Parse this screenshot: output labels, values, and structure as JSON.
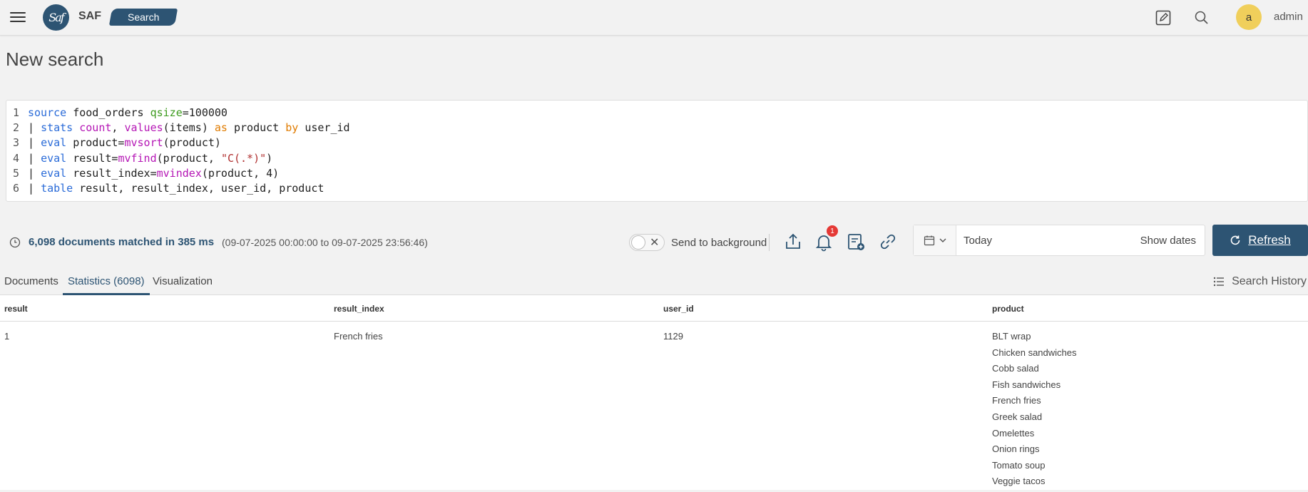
{
  "header": {
    "logo_text": "Saf",
    "app_name": "SAF",
    "nav_pill": "Search",
    "avatar_letter": "a",
    "username": "admin"
  },
  "page": {
    "title": "New search"
  },
  "editor": {
    "lines": [
      {
        "num": "1",
        "tokens": [
          [
            "kw",
            "source"
          ],
          [
            "plain",
            " food_orders "
          ],
          [
            "param",
            "qsize"
          ],
          [
            "plain",
            "=100000"
          ]
        ]
      },
      {
        "num": "2",
        "tokens": [
          [
            "plain",
            "| "
          ],
          [
            "kw",
            "stats "
          ],
          [
            "fn",
            "count"
          ],
          [
            "plain",
            ", "
          ],
          [
            "fn",
            "values"
          ],
          [
            "plain",
            "(items) "
          ],
          [
            "as",
            "as"
          ],
          [
            "plain",
            " product "
          ],
          [
            "as",
            "by"
          ],
          [
            "plain",
            " user_id"
          ]
        ]
      },
      {
        "num": "3",
        "tokens": [
          [
            "plain",
            "| "
          ],
          [
            "kw",
            "eval"
          ],
          [
            "plain",
            " product="
          ],
          [
            "fn",
            "mvsort"
          ],
          [
            "plain",
            "(product)"
          ]
        ]
      },
      {
        "num": "4",
        "tokens": [
          [
            "plain",
            "| "
          ],
          [
            "kw",
            "eval"
          ],
          [
            "plain",
            " result="
          ],
          [
            "fn",
            "mvfind"
          ],
          [
            "plain",
            "(product, "
          ],
          [
            "str",
            "\"C(.*)\""
          ],
          [
            "plain",
            ")"
          ]
        ]
      },
      {
        "num": "5",
        "tokens": [
          [
            "plain",
            "| "
          ],
          [
            "kw",
            "eval"
          ],
          [
            "plain",
            " result_index="
          ],
          [
            "fn",
            "mvindex"
          ],
          [
            "plain",
            "(product, 4)"
          ]
        ]
      },
      {
        "num": "6",
        "tokens": [
          [
            "plain",
            "| "
          ],
          [
            "kw",
            "table"
          ],
          [
            "plain",
            " result, result_index, user_id, product"
          ]
        ]
      }
    ]
  },
  "status": {
    "matched": "6,098 documents matched in 385 ms",
    "range": "(09-07-2025 00:00:00 to 09-07-2025 23:56:46)",
    "send_to_background": "Send to background",
    "notification_count": "1",
    "date_value": "Today",
    "show_dates": "Show dates",
    "refresh": "Refresh"
  },
  "tabs": [
    {
      "label": "Documents",
      "active": false
    },
    {
      "label": "Statistics (6098)",
      "active": true
    },
    {
      "label": "Visualization",
      "active": false
    }
  ],
  "search_history": "Search History",
  "table": {
    "columns": [
      "result",
      "result_index",
      "user_id",
      "product"
    ],
    "row": {
      "result": "1",
      "result_index": "French fries",
      "user_id": "1129",
      "product": [
        "BLT wrap",
        "Chicken sandwiches",
        "Cobb salad",
        "Fish sandwiches",
        "French fries",
        "Greek salad",
        "Omelettes",
        "Onion rings",
        "Tomato soup",
        "Veggie tacos"
      ]
    }
  },
  "colors": {
    "brand": "#2d5473",
    "avatar": "#f0cf5b",
    "badge": "#e53935"
  }
}
